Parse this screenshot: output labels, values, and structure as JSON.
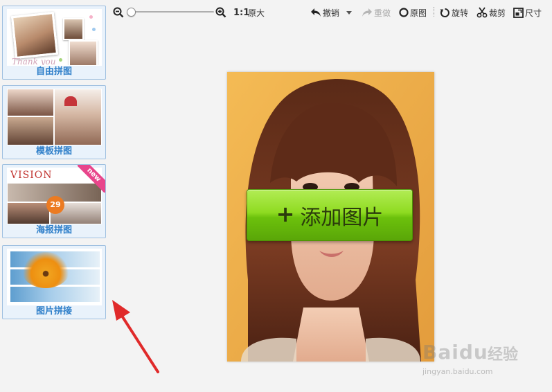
{
  "sidebar": {
    "items": [
      {
        "label": "自由拼图",
        "thumb_text": "Thank you"
      },
      {
        "label": "模板拼图"
      },
      {
        "label": "海报拼图",
        "thumb_text": "VISION",
        "thumb_number": "29",
        "badge": "new"
      },
      {
        "label": "图片拼接"
      }
    ]
  },
  "toolbar": {
    "one_to_one": "1:1",
    "original_size": "原大",
    "undo": "撤销",
    "redo": "重做",
    "original": "原图",
    "rotate": "旋转",
    "crop": "裁剪",
    "size": "尺寸",
    "zoom_level": 0
  },
  "canvas": {
    "add_button": "添加图片",
    "add_plus": "+"
  },
  "watermark": {
    "logo": "Baidu",
    "logo_cn": "经验",
    "url": "jingyan.baidu.com"
  },
  "colors": {
    "accent_blue": "#2f7fc9",
    "add_green": "#8fdb21",
    "arrow_red": "#e02a2a",
    "new_badge": "#e8458b"
  },
  "icons": [
    "zoom-out-icon",
    "zoom-in-icon",
    "undo-icon",
    "dropdown-icon",
    "redo-icon",
    "circle-icon",
    "rotate-icon",
    "scissors-icon",
    "resize-icon"
  ]
}
